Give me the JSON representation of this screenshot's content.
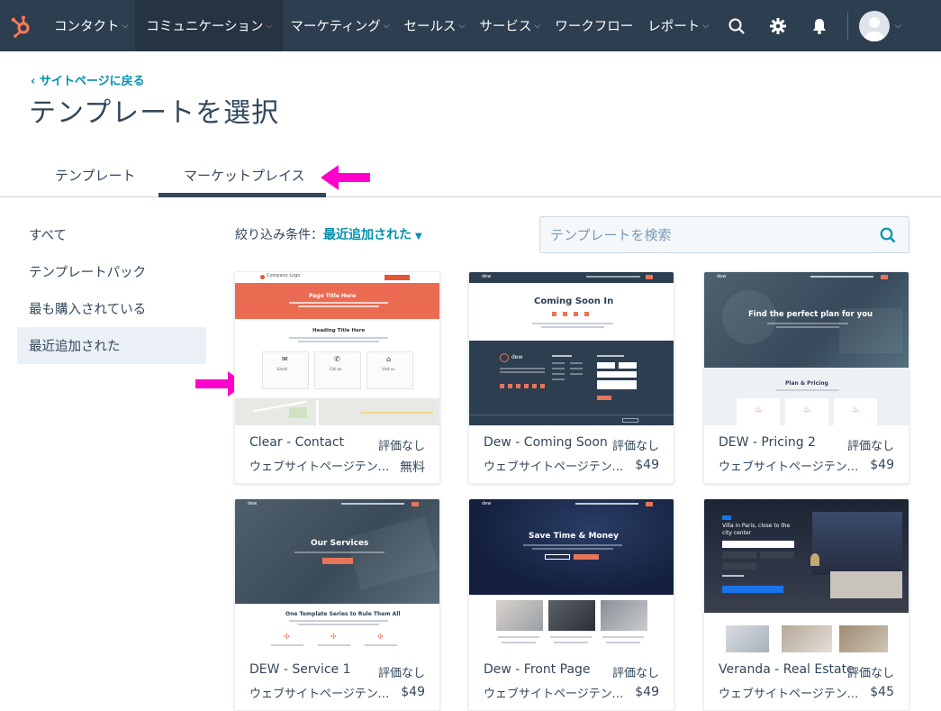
{
  "nav": {
    "items": [
      {
        "label": "コンタクト",
        "has_menu": true
      },
      {
        "label": "コミュニケーション",
        "has_menu": true,
        "active": true
      },
      {
        "label": "マーケティング",
        "has_menu": true
      },
      {
        "label": "セールス",
        "has_menu": true
      },
      {
        "label": "サービス",
        "has_menu": true
      },
      {
        "label": "ワークフロー",
        "has_menu": false
      },
      {
        "label": "レポート",
        "has_menu": true
      }
    ],
    "icons": [
      "search-icon",
      "gear-icon",
      "bell-icon"
    ],
    "brand_color": "#ff7a59",
    "bar_color": "#2d3e50"
  },
  "header": {
    "back_link": "‹  サイトページに戻る",
    "title": "テンプレートを選択"
  },
  "tabs": [
    {
      "label": "テンプレート",
      "active": false
    },
    {
      "label": "マーケットプレイス",
      "active": true
    }
  ],
  "sidebar": {
    "items": [
      {
        "label": "すべて",
        "active": false
      },
      {
        "label": "テンプレートパック",
        "active": false
      },
      {
        "label": "最も購入されている",
        "active": false
      },
      {
        "label": "最近追加された",
        "active": true
      }
    ]
  },
  "filter": {
    "label": "絞り込み条件：",
    "value": "最近追加された"
  },
  "search": {
    "placeholder": "テンプレートを検索"
  },
  "annotation_color": "#ff00cc",
  "templates": [
    {
      "name": "Clear - Contact",
      "rating": "評価なし",
      "category": "ウェブサイトページテンプ…",
      "price": "無料",
      "thumb": {
        "hero": "Page Title Here",
        "heading": "Heading Title Here",
        "logo": "Company Logo",
        "boxes": [
          "Email",
          "Call us",
          "Visit us"
        ]
      }
    },
    {
      "name": "Dew - Coming Soon",
      "rating": "評価なし",
      "category": "ウェブサイトページテンプ…",
      "price": "$49",
      "thumb": {
        "heading": "Coming Soon In",
        "logo": "dew"
      }
    },
    {
      "name": "DEW - Pricing 2",
      "rating": "評価なし",
      "category": "ウェブサイトページテンプ…",
      "price": "$49",
      "thumb": {
        "hero": "Find the perfect plan for you",
        "heading": "Plan & Pricing"
      }
    },
    {
      "name": "DEW - Service 1",
      "rating": "評価なし",
      "category": "ウェブサイトページテンプ…",
      "price": "$49",
      "thumb": {
        "hero": "Our Services",
        "heading": "One Template Series to Rule Them All"
      }
    },
    {
      "name": "Dew - Front Page",
      "rating": "評価なし",
      "category": "ウェブサイトページテンプ…",
      "price": "$49",
      "thumb": {
        "hero": "Save Time & Money"
      }
    },
    {
      "name": "Veranda - Real Estate",
      "rating": "評価なし",
      "category": "ウェブサイトページテンプ…",
      "price": "$45",
      "thumb": {
        "hero": "Villa in Paris, close to the city center"
      }
    }
  ]
}
